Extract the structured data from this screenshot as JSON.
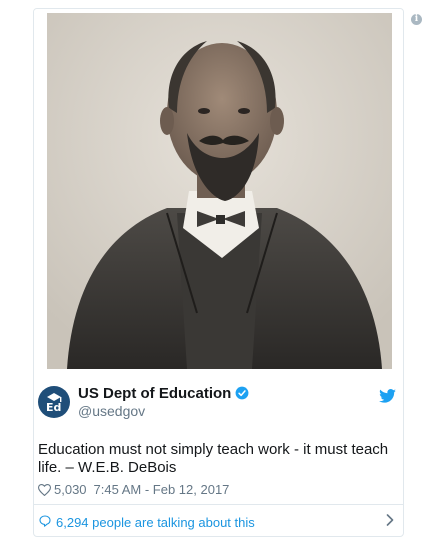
{
  "tweet": {
    "author_name": "US Dept of Education",
    "author_handle": "@usedgov",
    "text": "Education must not simply teach work - it must teach life. – W.E.B. DeBois",
    "likes": "5,030",
    "timestamp": "7:45 AM - Feb 12, 2017",
    "talking_about": "6,294 people are talking about this"
  },
  "icons": {
    "info": "info-icon",
    "verified": "verified-badge-icon",
    "twitter": "twitter-bird-icon",
    "like": "heart-icon",
    "reply": "speech-bubble-icon",
    "more": "chevron-right-icon"
  },
  "colors": {
    "accent": "#1b95e0",
    "verified": "#1da1f2",
    "muted": "#657786",
    "avatar_bg": "#1f4e79"
  }
}
